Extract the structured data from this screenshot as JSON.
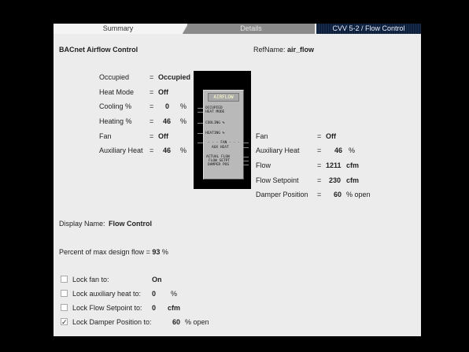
{
  "tabs": [
    {
      "label": "Summary"
    },
    {
      "label": "Details"
    },
    {
      "label": "CVV 5-2 / Flow Control"
    }
  ],
  "header": {
    "heading": "BACnet Airflow Control",
    "refname_label": "RefName:",
    "refname_value": "air_flow"
  },
  "left_values": {
    "occupied": {
      "label": "Occupied",
      "eq": "=",
      "value": "Occupied",
      "unit": ""
    },
    "heat_mode": {
      "label": "Heat Mode",
      "eq": "=",
      "value": "Off",
      "unit": ""
    },
    "cooling": {
      "label": "Cooling %",
      "eq": "=",
      "value": "0",
      "unit": "%"
    },
    "heating": {
      "label": "Heating %",
      "eq": "=",
      "value": "46",
      "unit": "%"
    },
    "fan": {
      "label": "Fan",
      "eq": "=",
      "value": "Off",
      "unit": ""
    },
    "aux_heat": {
      "label": "Auxiliary Heat",
      "eq": "=",
      "value": "46",
      "unit": "%"
    }
  },
  "device": {
    "title": "AIRFLOW",
    "inputs": [
      "OCCUPIED",
      "HEAT MODE",
      "COOLING %",
      "HEATING %"
    ],
    "fan_line": "- - - FAN - - -",
    "outputs": [
      "AUX HEAT",
      "ACTUAL FLOW",
      "FLOW SETPT",
      "DAMPER POS"
    ]
  },
  "right_values": {
    "fan": {
      "label": "Fan",
      "eq": "=",
      "value": "Off",
      "unit": ""
    },
    "aux_heat": {
      "label": "Auxiliary Heat",
      "eq": "=",
      "value": "46",
      "unit": "%"
    },
    "flow": {
      "label": "Flow",
      "eq": "=",
      "value": "1211",
      "unit": "cfm"
    },
    "flow_setpoint": {
      "label": "Flow Setpoint",
      "eq": "=",
      "value": "230",
      "unit": "cfm"
    },
    "damper_position": {
      "label": "Damper Position",
      "eq": "=",
      "value": "60",
      "unit": "% open"
    }
  },
  "display_name": {
    "label": "Display Name:",
    "value": "Flow Control"
  },
  "percent_max": {
    "label": "Percent of max design flow",
    "eq": "=",
    "value": "93",
    "unit": "%"
  },
  "locks": [
    {
      "label": "Lock fan to:",
      "value": "On",
      "unit": "",
      "checked": false
    },
    {
      "label": "Lock auxiliary heat to:",
      "value": "0",
      "unit": "%",
      "checked": false
    },
    {
      "label": "Lock Flow Setpoint to:",
      "value": "0",
      "unit": "cfm",
      "checked": false
    },
    {
      "label": "Lock Damper Position to:",
      "value": "60",
      "unit": "% open",
      "checked": true
    }
  ],
  "check_glyph": "✓"
}
